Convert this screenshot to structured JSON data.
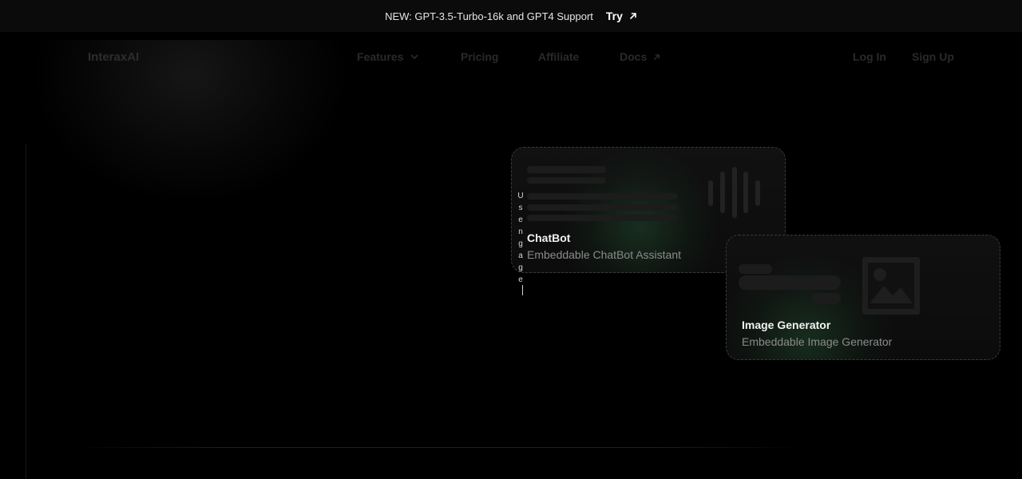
{
  "announcement": {
    "message": "NEW: GPT-3.5-Turbo-16k and GPT4 Support",
    "cta_label": "Try"
  },
  "nav": {
    "brand": "InteraxAI",
    "items": [
      {
        "label": "Features",
        "icon": "chevron-down-icon"
      },
      {
        "label": "Pricing"
      },
      {
        "label": "Affiliate"
      },
      {
        "label": "Docs",
        "icon": "arrow-up-right-icon"
      }
    ],
    "login_label": "Log In",
    "signup_label": "Sign Up"
  },
  "hero": {
    "vertical_text": "Usengage"
  },
  "cards": [
    {
      "title": "ChatBot",
      "subtitle": "Embeddable ChatBot Assistant",
      "icon": "waveform-icon"
    },
    {
      "title": "Image Generator",
      "subtitle": "Embeddable Image Generator",
      "icon": "image-icon"
    }
  ],
  "colors": {
    "background": "#000000",
    "announcement_bg": "#0b0b0b",
    "accent_glow": "#3ca05a",
    "card_border": "#3a3a3a"
  }
}
